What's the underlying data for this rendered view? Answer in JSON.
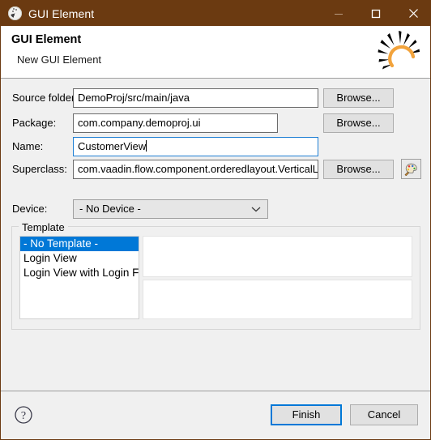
{
  "window": {
    "title": "GUI Element",
    "icon": "eclipse-wizard-icon",
    "accent_brown": "#6b3a11",
    "accent_blue": "#0078d7",
    "controls": {
      "minimize": "minimize-icon",
      "maximize": "maximize-icon",
      "close": "close-icon"
    }
  },
  "header": {
    "title": "GUI Element",
    "subtitle": "New GUI Element",
    "logo": "eclipse-sun-rays-logo"
  },
  "form": {
    "fields": [
      {
        "label": "Source folder:",
        "value": "DemoProj/src/main/java",
        "button": "Browse...",
        "focused": false
      },
      {
        "label": "Package:",
        "value": "com.company.demoproj.ui",
        "button": "Browse...",
        "focused": false
      },
      {
        "label": "Name:",
        "value": "CustomerView",
        "button": "",
        "focused": true
      },
      {
        "label": "Superclass:",
        "value": "com.vaadin.flow.component.orderedlayout.VerticalLayout",
        "button": "Browse...",
        "focused": false
      }
    ],
    "extra_button_icon": "palette-icon"
  },
  "device": {
    "label": "Device:",
    "value": "- No Device -",
    "chevron": "chevron-down-icon",
    "options": [
      "- No Device -"
    ]
  },
  "template": {
    "group_label": "Template",
    "items": [
      {
        "label": "- No Template -",
        "selected": true
      },
      {
        "label": "Login View",
        "selected": false
      },
      {
        "label": "Login View with Login Form",
        "selected": false
      }
    ],
    "preview_panels": [
      "",
      ""
    ]
  },
  "footer": {
    "help_icon": "help-question-icon",
    "finish_label": "Finish",
    "cancel_label": "Cancel"
  }
}
